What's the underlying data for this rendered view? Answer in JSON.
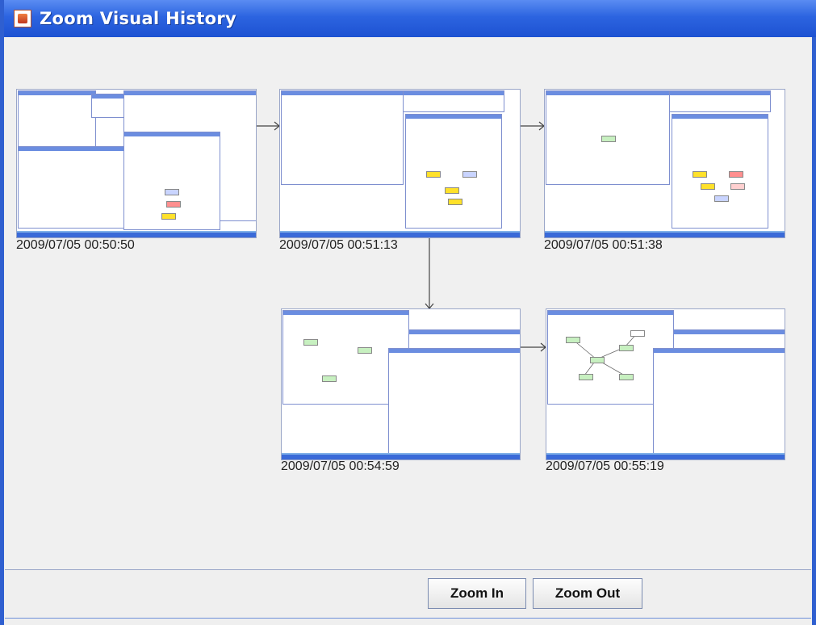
{
  "window": {
    "title": "Zoom Visual History"
  },
  "history": [
    {
      "timestamp": "2009/07/05 00:50:50"
    },
    {
      "timestamp": "2009/07/05 00:51:13"
    },
    {
      "timestamp": "2009/07/05 00:51:38"
    },
    {
      "timestamp": "2009/07/05 00:54:59"
    },
    {
      "timestamp": "2009/07/05 00:55:19"
    }
  ],
  "buttons": {
    "zoom_in": "Zoom In",
    "zoom_out": "Zoom Out"
  },
  "colors": {
    "titlebar": "#2c64e0",
    "background": "#f0f0f0",
    "border": "#2f5fd0"
  }
}
